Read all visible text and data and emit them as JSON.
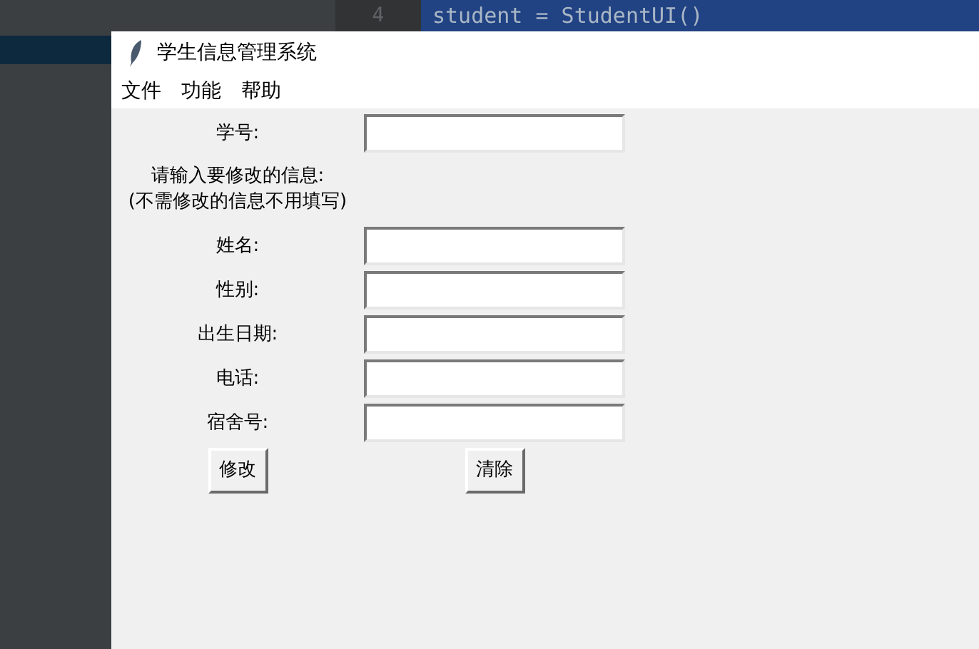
{
  "editor": {
    "line_number": "4",
    "code_line": "student = StudentUI()"
  },
  "window": {
    "title": "学生信息管理系统"
  },
  "menu": [
    "文件",
    "功能",
    "帮助"
  ],
  "id_field": {
    "label": "学号:"
  },
  "note": [
    "请输入要修改的信息:",
    "(不需修改的信息不用填写)"
  ],
  "fields": [
    {
      "label": "姓名:"
    },
    {
      "label": "性别:"
    },
    {
      "label": "出生日期:"
    },
    {
      "label": "电话:"
    },
    {
      "label": "宿舍号:"
    }
  ],
  "buttons": [
    "修改",
    "清除"
  ]
}
